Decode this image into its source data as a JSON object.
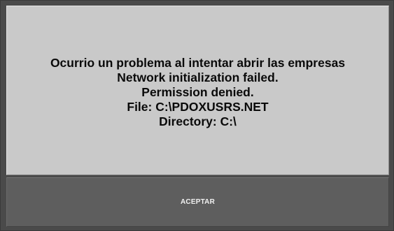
{
  "dialog": {
    "message_lines": [
      "Ocurrio un problema al intentar abrir las empresas",
      "Network initialization failed.",
      "Permission denied.",
      "File: C:\\PDOXUSRS.NET",
      "Directory: C:\\"
    ],
    "accept_label": "ACEPTAR"
  }
}
